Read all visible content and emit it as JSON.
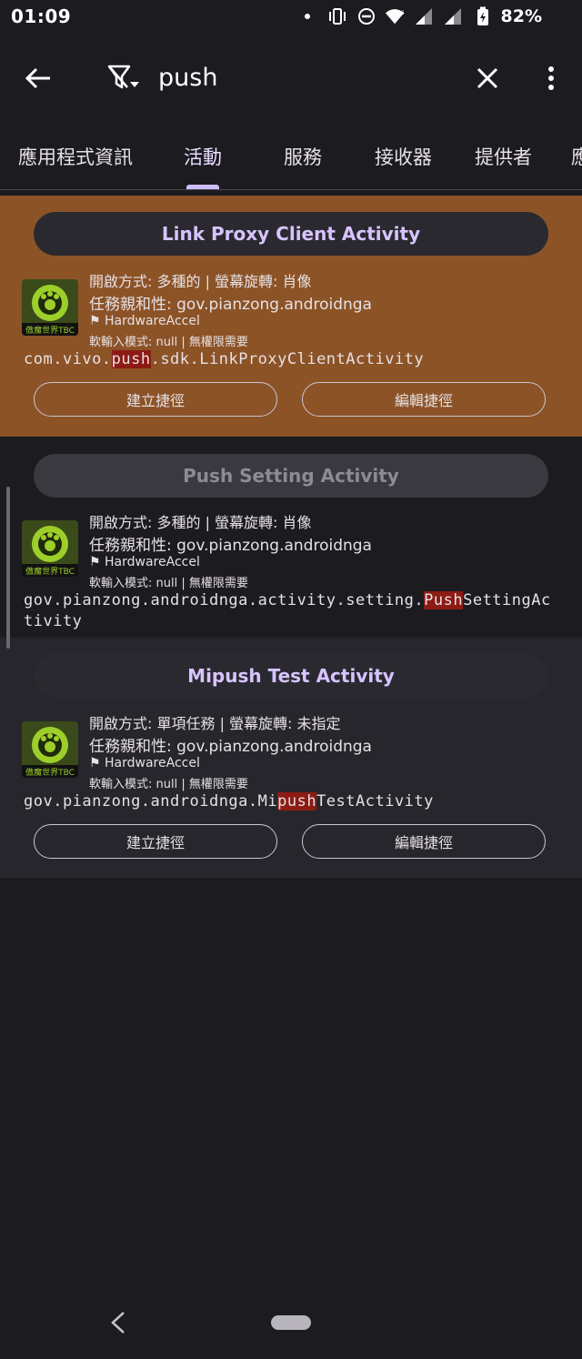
{
  "status_bar": {
    "time": "01:09",
    "battery": "82%",
    "icons": [
      "dot-icon",
      "vibrate-icon",
      "dnd-icon",
      "wifi-icon",
      "signal-icon",
      "signal-icon",
      "battery-charging-icon"
    ]
  },
  "app_bar": {
    "search_value": "push",
    "icons": [
      "back-arrow-icon",
      "filter-icon",
      "close-icon",
      "more-vert-icon"
    ]
  },
  "tabs": [
    {
      "label": "應用程式資訊"
    },
    {
      "label": "活動"
    },
    {
      "label": "服務"
    },
    {
      "label": "接收器"
    },
    {
      "label": "提供者"
    },
    {
      "label": "應"
    }
  ],
  "active_tab_index": 1,
  "activities": [
    {
      "title": "Link Proxy Client Activity",
      "info_launch": "開啟方式: 多種的 | 螢幕旋轉: 肖像",
      "info_affinity": "任務親和性: gov.pianzong.androidnga",
      "info_flag": "HardwareAccel",
      "info_input": "軟輸入模式: null | 無權限需要",
      "class_pre": "com.vivo.",
      "class_hl": "push",
      "class_post": ".sdk.LinkProxyClientActivity",
      "button_shortcut": "建立捷徑",
      "button_edit": "編輯捷徑",
      "app_icon_label": "傲魔世界TBC",
      "background": "#8c5327"
    },
    {
      "title": "Push Setting Activity",
      "info_launch": "開啟方式: 多種的 | 螢幕旋轉: 肖像",
      "info_affinity": "任務親和性: gov.pianzong.androidnga",
      "info_flag": "HardwareAccel",
      "info_input": "軟輸入模式: null | 無權限需要",
      "class_pre": "gov.pianzong.androidnga.activity.setting.",
      "class_hl": "Push",
      "class_post": "SettingActivity",
      "app_icon_label": "傲魔世界TBC",
      "background": "#1c1b20"
    },
    {
      "title": "Mipush Test Activity",
      "info_launch": "開啟方式: 單項任務 | 螢幕旋轉: 未指定",
      "info_affinity": "任務親和性: gov.pianzong.androidnga",
      "info_flag": "HardwareAccel",
      "info_input": "軟輸入模式: null | 無權限需要",
      "class_pre": "gov.pianzong.androidnga.Mi",
      "class_hl": "push",
      "class_post": "TestActivity",
      "button_shortcut": "建立捷徑",
      "button_edit": "編輯捷徑",
      "app_icon_label": "傲魔世界TBC",
      "background": "#27262c"
    }
  ],
  "nav_bar": {
    "icons": [
      "nav-back-icon",
      "nav-home-pill"
    ]
  },
  "colors": {
    "accent": "#cfbcff",
    "highlight": "#8c1b14",
    "background": "#1c1b20"
  }
}
